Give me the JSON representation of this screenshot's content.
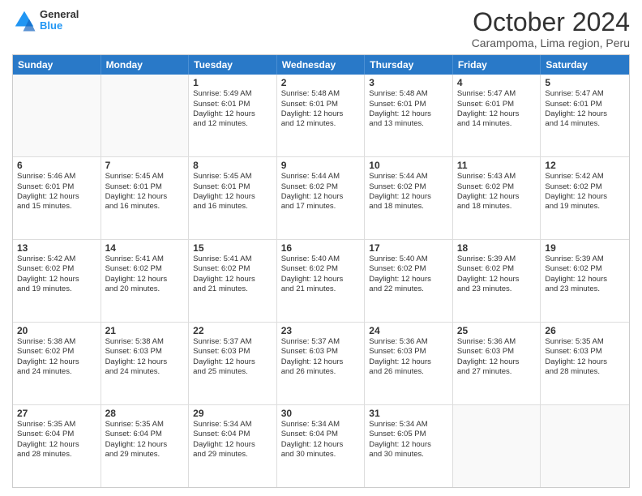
{
  "logo": {
    "line1": "General",
    "line2": "Blue"
  },
  "title": "October 2024",
  "subtitle": "Carampoma, Lima region, Peru",
  "header": {
    "days": [
      "Sunday",
      "Monday",
      "Tuesday",
      "Wednesday",
      "Thursday",
      "Friday",
      "Saturday"
    ]
  },
  "weeks": [
    {
      "cells": [
        {
          "day": "",
          "text": ""
        },
        {
          "day": "",
          "text": ""
        },
        {
          "day": "1",
          "text": "Sunrise: 5:49 AM\nSunset: 6:01 PM\nDaylight: 12 hours\nand 12 minutes."
        },
        {
          "day": "2",
          "text": "Sunrise: 5:48 AM\nSunset: 6:01 PM\nDaylight: 12 hours\nand 12 minutes."
        },
        {
          "day": "3",
          "text": "Sunrise: 5:48 AM\nSunset: 6:01 PM\nDaylight: 12 hours\nand 13 minutes."
        },
        {
          "day": "4",
          "text": "Sunrise: 5:47 AM\nSunset: 6:01 PM\nDaylight: 12 hours\nand 14 minutes."
        },
        {
          "day": "5",
          "text": "Sunrise: 5:47 AM\nSunset: 6:01 PM\nDaylight: 12 hours\nand 14 minutes."
        }
      ]
    },
    {
      "cells": [
        {
          "day": "6",
          "text": "Sunrise: 5:46 AM\nSunset: 6:01 PM\nDaylight: 12 hours\nand 15 minutes."
        },
        {
          "day": "7",
          "text": "Sunrise: 5:45 AM\nSunset: 6:01 PM\nDaylight: 12 hours\nand 16 minutes."
        },
        {
          "day": "8",
          "text": "Sunrise: 5:45 AM\nSunset: 6:01 PM\nDaylight: 12 hours\nand 16 minutes."
        },
        {
          "day": "9",
          "text": "Sunrise: 5:44 AM\nSunset: 6:02 PM\nDaylight: 12 hours\nand 17 minutes."
        },
        {
          "day": "10",
          "text": "Sunrise: 5:44 AM\nSunset: 6:02 PM\nDaylight: 12 hours\nand 18 minutes."
        },
        {
          "day": "11",
          "text": "Sunrise: 5:43 AM\nSunset: 6:02 PM\nDaylight: 12 hours\nand 18 minutes."
        },
        {
          "day": "12",
          "text": "Sunrise: 5:42 AM\nSunset: 6:02 PM\nDaylight: 12 hours\nand 19 minutes."
        }
      ]
    },
    {
      "cells": [
        {
          "day": "13",
          "text": "Sunrise: 5:42 AM\nSunset: 6:02 PM\nDaylight: 12 hours\nand 19 minutes."
        },
        {
          "day": "14",
          "text": "Sunrise: 5:41 AM\nSunset: 6:02 PM\nDaylight: 12 hours\nand 20 minutes."
        },
        {
          "day": "15",
          "text": "Sunrise: 5:41 AM\nSunset: 6:02 PM\nDaylight: 12 hours\nand 21 minutes."
        },
        {
          "day": "16",
          "text": "Sunrise: 5:40 AM\nSunset: 6:02 PM\nDaylight: 12 hours\nand 21 minutes."
        },
        {
          "day": "17",
          "text": "Sunrise: 5:40 AM\nSunset: 6:02 PM\nDaylight: 12 hours\nand 22 minutes."
        },
        {
          "day": "18",
          "text": "Sunrise: 5:39 AM\nSunset: 6:02 PM\nDaylight: 12 hours\nand 23 minutes."
        },
        {
          "day": "19",
          "text": "Sunrise: 5:39 AM\nSunset: 6:02 PM\nDaylight: 12 hours\nand 23 minutes."
        }
      ]
    },
    {
      "cells": [
        {
          "day": "20",
          "text": "Sunrise: 5:38 AM\nSunset: 6:02 PM\nDaylight: 12 hours\nand 24 minutes."
        },
        {
          "day": "21",
          "text": "Sunrise: 5:38 AM\nSunset: 6:03 PM\nDaylight: 12 hours\nand 24 minutes."
        },
        {
          "day": "22",
          "text": "Sunrise: 5:37 AM\nSunset: 6:03 PM\nDaylight: 12 hours\nand 25 minutes."
        },
        {
          "day": "23",
          "text": "Sunrise: 5:37 AM\nSunset: 6:03 PM\nDaylight: 12 hours\nand 26 minutes."
        },
        {
          "day": "24",
          "text": "Sunrise: 5:36 AM\nSunset: 6:03 PM\nDaylight: 12 hours\nand 26 minutes."
        },
        {
          "day": "25",
          "text": "Sunrise: 5:36 AM\nSunset: 6:03 PM\nDaylight: 12 hours\nand 27 minutes."
        },
        {
          "day": "26",
          "text": "Sunrise: 5:35 AM\nSunset: 6:03 PM\nDaylight: 12 hours\nand 28 minutes."
        }
      ]
    },
    {
      "cells": [
        {
          "day": "27",
          "text": "Sunrise: 5:35 AM\nSunset: 6:04 PM\nDaylight: 12 hours\nand 28 minutes."
        },
        {
          "day": "28",
          "text": "Sunrise: 5:35 AM\nSunset: 6:04 PM\nDaylight: 12 hours\nand 29 minutes."
        },
        {
          "day": "29",
          "text": "Sunrise: 5:34 AM\nSunset: 6:04 PM\nDaylight: 12 hours\nand 29 minutes."
        },
        {
          "day": "30",
          "text": "Sunrise: 5:34 AM\nSunset: 6:04 PM\nDaylight: 12 hours\nand 30 minutes."
        },
        {
          "day": "31",
          "text": "Sunrise: 5:34 AM\nSunset: 6:05 PM\nDaylight: 12 hours\nand 30 minutes."
        },
        {
          "day": "",
          "text": ""
        },
        {
          "day": "",
          "text": ""
        }
      ]
    }
  ]
}
